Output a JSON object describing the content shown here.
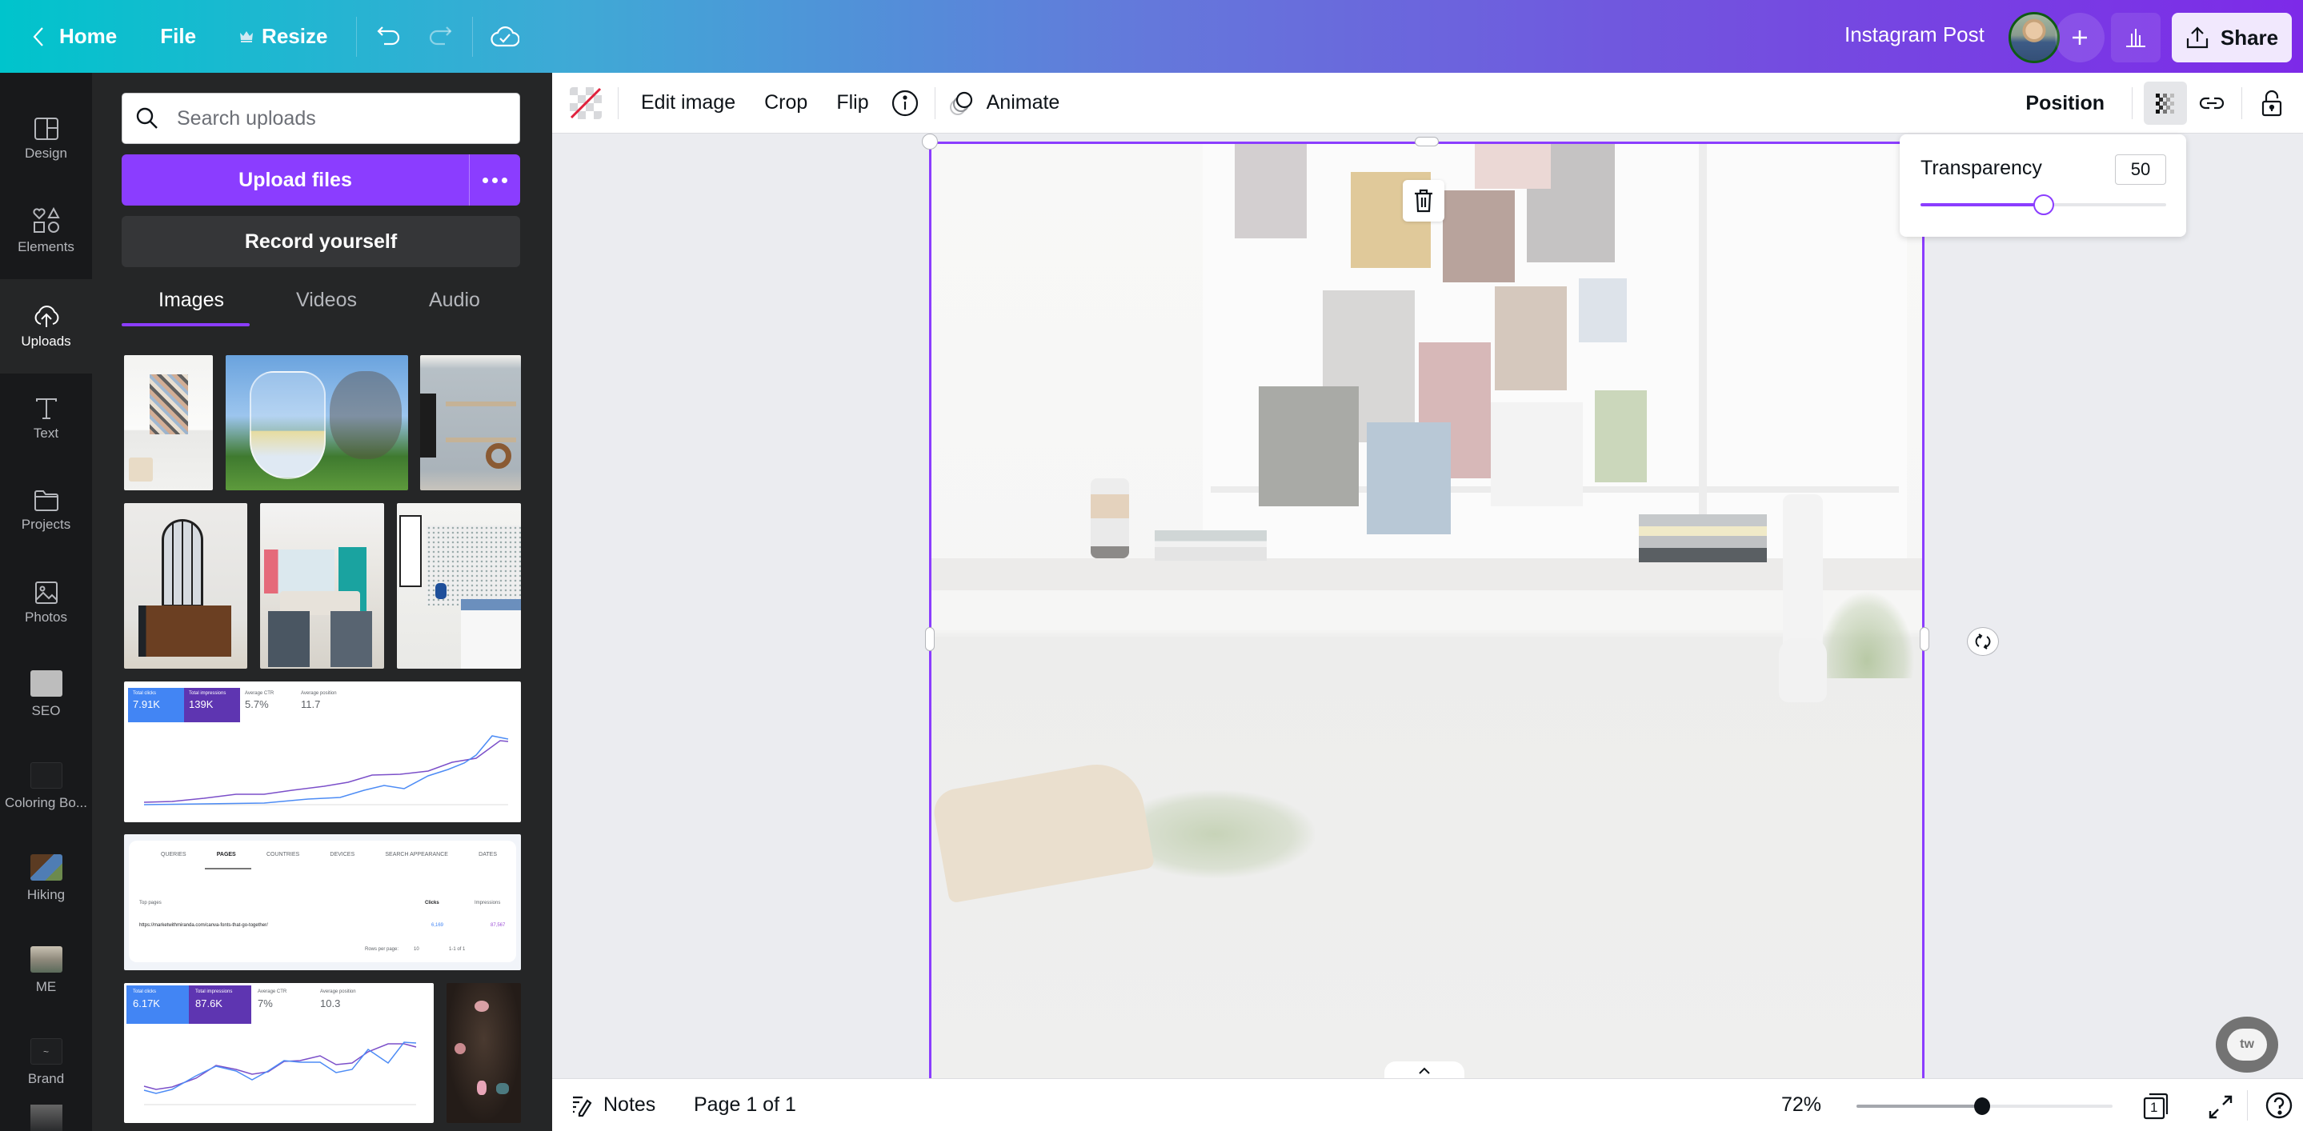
{
  "header": {
    "home": "Home",
    "file": "File",
    "resize": "Resize",
    "title": "Instagram Post",
    "share": "Share",
    "colors": {
      "gradient_start": "#00c4cc",
      "gradient_end": "#7d2ae8"
    }
  },
  "rail": {
    "items": [
      {
        "label": "Design",
        "icon": "layout-icon"
      },
      {
        "label": "Elements",
        "icon": "shapes-icon"
      },
      {
        "label": "Uploads",
        "icon": "cloud-upload-icon",
        "active": true
      },
      {
        "label": "Text",
        "icon": "text-icon"
      },
      {
        "label": "Projects",
        "icon": "folder-icon"
      },
      {
        "label": "Photos",
        "icon": "image-icon"
      },
      {
        "label": "SEO",
        "icon": "folder-thumbnail"
      },
      {
        "label": "Coloring Bo...",
        "icon": "folder-thumbnail"
      },
      {
        "label": "Hiking",
        "icon": "folder-thumbnail"
      },
      {
        "label": "ME",
        "icon": "folder-thumbnail"
      },
      {
        "label": "Brand",
        "icon": "folder-thumbnail"
      }
    ]
  },
  "panel": {
    "search_placeholder": "Search uploads",
    "upload_button": "Upload files",
    "record_button": "Record yourself",
    "tabs": [
      {
        "label": "Images",
        "active": true
      },
      {
        "label": "Videos"
      },
      {
        "label": "Audio"
      }
    ],
    "thumbnails": [
      {
        "name": "moodboard-window",
        "desc": "White window sill with moodboard"
      },
      {
        "name": "wine-glass",
        "desc": "Buckley Vineyards wine glass"
      },
      {
        "name": "shelves",
        "desc": "Floating shelves decor"
      },
      {
        "name": "arched-mirror",
        "desc": "Arched mirror over console"
      },
      {
        "name": "living-room",
        "desc": "Living room with teal wall"
      },
      {
        "name": "bedroom",
        "desc": "Bedroom with bicycle print"
      },
      {
        "name": "search-console-1",
        "desc": "Search performance chart",
        "stats": [
          {
            "label": "Total clicks",
            "value": "7.91K"
          },
          {
            "label": "Total impressions",
            "value": "139K"
          },
          {
            "label": "Average CTR",
            "value": "5.7%"
          },
          {
            "label": "Average position",
            "value": "11.7"
          }
        ]
      },
      {
        "name": "search-console-pages",
        "desc": "Top pages table",
        "tabs": [
          "QUERIES",
          "PAGES",
          "COUNTRIES",
          "DEVICES",
          "SEARCH APPEARANCE",
          "DATES"
        ],
        "columns": [
          "Top pages",
          "Clicks",
          "Impressions"
        ],
        "row": {
          "page": "https://marketwithmiranda.com/canva-fonts-that-go-together/",
          "clicks": "6,169",
          "impressions": "87,567"
        },
        "footer": {
          "rows_per_page_label": "Rows per page:",
          "rows_per_page": "10",
          "range": "1-1 of 1"
        }
      },
      {
        "name": "search-console-2",
        "desc": "Search performance chart",
        "stats": [
          {
            "label": "Total clicks",
            "value": "6.17K"
          },
          {
            "label": "Total impressions",
            "value": "87.6K"
          },
          {
            "label": "Average CTR",
            "value": "7%"
          },
          {
            "label": "Average position",
            "value": "10.3"
          }
        ]
      },
      {
        "name": "sticker-search",
        "desc": "Sweater weather stickers"
      }
    ]
  },
  "toolbar": {
    "edit_image": "Edit image",
    "crop": "Crop",
    "flip": "Flip",
    "animate": "Animate",
    "position": "Position"
  },
  "transparency": {
    "label": "Transparency",
    "value": "50",
    "fraction": 0.5
  },
  "bottombar": {
    "notes": "Notes",
    "page": "Page 1 of 1",
    "zoom": "72%",
    "zoom_fraction": 0.49,
    "page_count": "1"
  },
  "colors": {
    "accent": "#8b3dff",
    "panel_bg": "#252627",
    "rail_bg": "#18191b",
    "canvas_bg": "#ebecf0"
  }
}
